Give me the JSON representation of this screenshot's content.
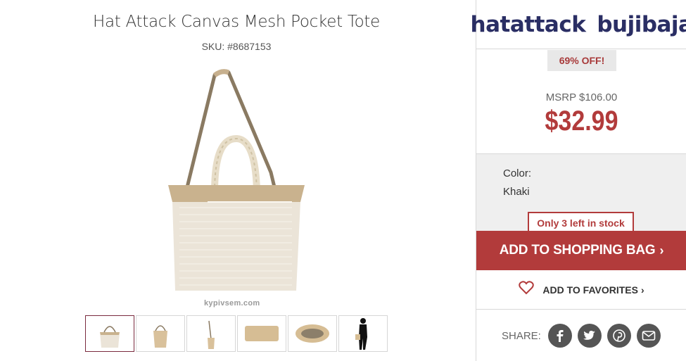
{
  "product": {
    "title": "Hat Attack Canvas Mesh Pocket Tote",
    "sku": "SKU: #8687153",
    "watermark": "kypivsem.com",
    "thumbnails": [
      "tote-front",
      "tote-side",
      "tote-strap",
      "pocket",
      "tote-top",
      "model"
    ]
  },
  "brand": {
    "part1": "hatattack",
    "part2": "bujibaja"
  },
  "pricing": {
    "discount": "69% OFF!",
    "msrp": "MSRP $106.00",
    "price": "$32.99"
  },
  "options": {
    "color_label": "Color:",
    "color_value": "Khaki",
    "stock": "Only 3 left in stock"
  },
  "actions": {
    "add_to_bag": "ADD TO SHOPPING BAG",
    "add_to_favorites": "ADD TO FAVORITES",
    "share_label": "SHARE:"
  },
  "social_icons": [
    "facebook-icon",
    "twitter-icon",
    "pinterest-icon",
    "email-icon"
  ],
  "colors": {
    "accent": "#b23b3b",
    "brand_navy": "#2a2e64",
    "panel_gray": "#efefef"
  }
}
